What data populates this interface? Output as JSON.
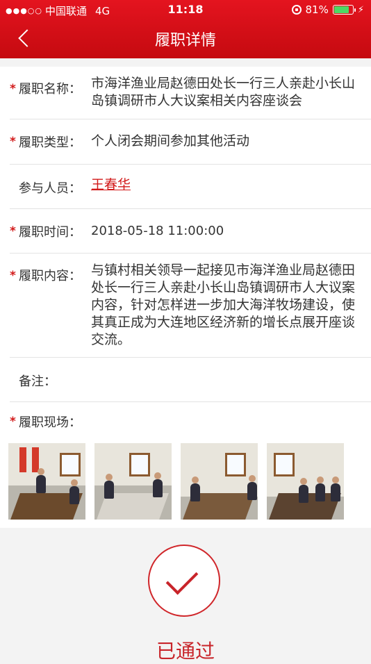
{
  "status_bar": {
    "signal": "●●●○○",
    "carrier": "中国联通",
    "network": "4G",
    "time": "11:18",
    "battery": "81%"
  },
  "nav": {
    "title": "履职详情"
  },
  "fields": {
    "name": {
      "label": "履职名称：",
      "value": "市海洋渔业局赵德田处长一行三人亲赴小长山岛镇调研市人大议案相关内容座谈会",
      "required": true
    },
    "type": {
      "label": "履职类型：",
      "value": "个人闭会期间参加其他活动",
      "required": true
    },
    "participants": {
      "label": "参与人员：",
      "value": "王春华",
      "required": false
    },
    "time": {
      "label": "履职时间：",
      "value": "2018-05-18 11:00:00",
      "required": true
    },
    "content": {
      "label": "履职内容：",
      "value": "与镇村相关领导一起接见市海洋渔业局赵德田处长一行三人亲赴小长山岛镇调研市人大议案内容，针对怎样进一步加大海洋牧场建设，使其真正成为大连地区经济新的增长点展开座谈交流。",
      "required": true
    },
    "remark": {
      "label": "备注：",
      "value": "",
      "required": false
    },
    "scene": {
      "label": "履职现场：",
      "required": true
    }
  },
  "star": "*",
  "photos": [
    "meeting-photo-1",
    "meeting-photo-2",
    "meeting-photo-3",
    "meeting-photo-4"
  ],
  "status": {
    "text": "已通过",
    "icon": "check-icon",
    "color": "#c8242a"
  }
}
